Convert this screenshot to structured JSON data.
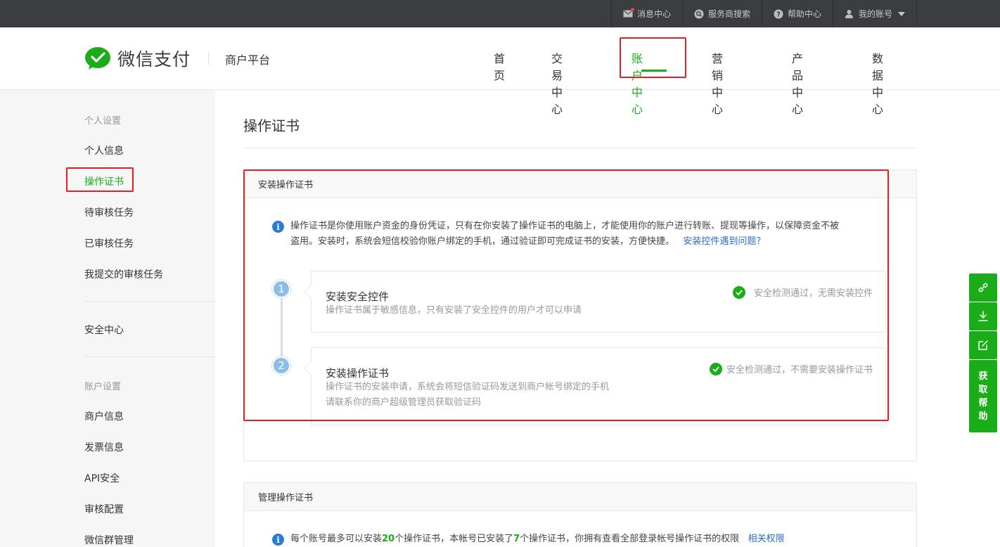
{
  "topbar": {
    "items": [
      {
        "label": "消息中心",
        "icon": "mail-icon"
      },
      {
        "label": "服务商搜索",
        "icon": "search-icon"
      },
      {
        "label": "帮助中心",
        "icon": "help-icon"
      },
      {
        "label": "我的账号",
        "icon": "user-icon"
      }
    ]
  },
  "header": {
    "logo_text": "微信支付",
    "platform": "商户平台",
    "nav": [
      "首页",
      "交易中心",
      "账户中心",
      "营销中心",
      "产品中心",
      "数据中心"
    ],
    "active_nav": "账户中心"
  },
  "sidebar": {
    "group1": "个人设置",
    "items1": [
      "个人信息",
      "操作证书",
      "待审核任务",
      "已审核任务",
      "我提交的审核任务"
    ],
    "active": "操作证书",
    "security": "安全中心",
    "group2": "账户设置",
    "items2": [
      "商户信息",
      "发票信息",
      "API安全",
      "审核配置",
      "微信群管理"
    ]
  },
  "main": {
    "title": "操作证书",
    "install_panel": {
      "title": "安装操作证书",
      "info_line1": "操作证书是你使用账户资金的身份凭证，只有在你安装了操作证书的电脑上，才能使用你的账户进行转账、提现等操作，以保障资金不被",
      "info_line2": "盗用。安装时，系统会短信校验你账户绑定的手机，通过验证即可完成证书的安装，方便快捷。",
      "info_link": "安装控件遇到问题？",
      "steps": [
        {
          "number": "1",
          "title": "安装安全控件",
          "desc1": "操作证书属于敏感信息，只有安装了安全控件的用户才可以申请",
          "desc2": "",
          "status": "安全检测通过，无需安装控件"
        },
        {
          "number": "2",
          "title": "安装操作证书",
          "desc1": "操作证书的安装申请，系统会将短信验证码发送到商户帐号绑定的手机",
          "desc2": "请联系你的商户超级管理员获取验证码",
          "status": "安全检测通过，不需要安装操作证书"
        }
      ]
    },
    "manage_panel": {
      "title": "管理操作证书",
      "info_a": "每个账号最多可以安装",
      "max_count": "20",
      "info_b": "个操作证书，本帐号已安装了",
      "installed_count": "7",
      "info_c": "个操作证书，你拥有查看全部登录帐号操作证书的权限",
      "link": "相关权限"
    }
  },
  "float_bar": {
    "help_label": [
      "获",
      "取",
      "帮",
      "助"
    ]
  },
  "colors": {
    "brand_green": "#1aad19",
    "topbar_bg": "#3b3c3f",
    "link_blue": "#2b6dc6",
    "highlight_red": "#e02121"
  }
}
